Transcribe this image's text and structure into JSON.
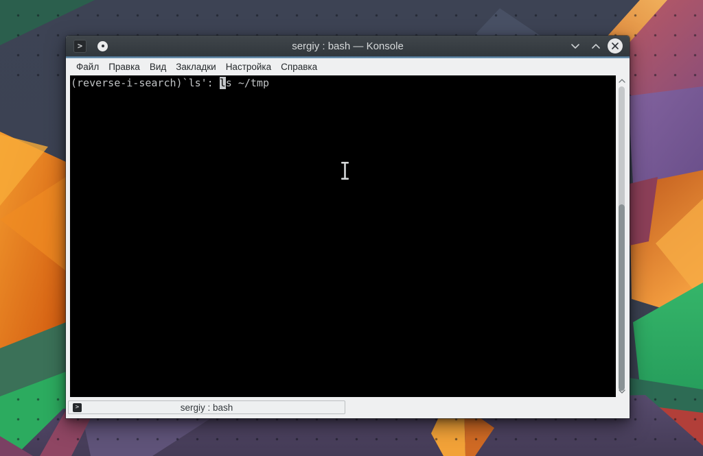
{
  "window": {
    "title": "sergiy : bash — Konsole",
    "app_icon_glyph": ">",
    "menu_items": [
      "Файл",
      "Правка",
      "Вид",
      "Закладки",
      "Настройка",
      "Справка"
    ],
    "terminal": {
      "line_prefix": "(reverse-i-search)`ls': ",
      "cursor_char": "l",
      "line_suffix": "s ~/tmp"
    },
    "tab": {
      "icon_glyph": ">",
      "label": "sergiy : bash"
    },
    "scrollbar": {
      "thumb_top_percent": 40,
      "thumb_height_percent": 58
    }
  },
  "colors": {
    "titlebar_top": "#40464b",
    "titlebar_bottom": "#31373c",
    "titlebar_text": "#d7dadb",
    "accent_line": "#4f7d9e",
    "menubar_bg": "#eff0f1",
    "menubar_text": "#24282b",
    "terminal_bg": "#000000",
    "terminal_text": "#c0c3c5",
    "terminal_cursor": "#c6c9cb",
    "scrollbar_thumb": "#8a9295",
    "scrollbar_track": "#c5c8ca",
    "wallpaper_slate": "#3e4454",
    "wallpaper_orange": "#e8831f",
    "wallpaper_green": "#2cab5f",
    "wallpaper_purple": "#54496b"
  }
}
